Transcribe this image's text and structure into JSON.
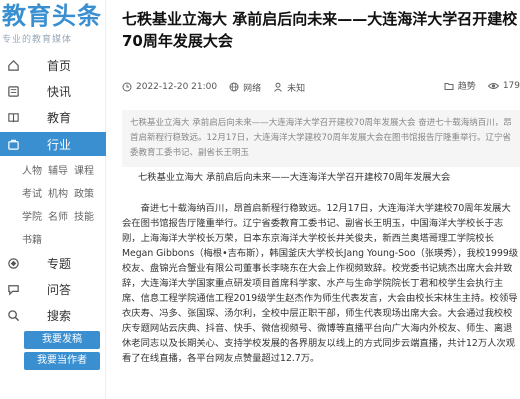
{
  "logo": {
    "main": "教育头条",
    "sub": "专业的教育媒体"
  },
  "nav": {
    "home": "首页",
    "news": "快讯",
    "education": "教育",
    "industry": "行业",
    "sub_items": [
      "人物",
      "辅导",
      "课程",
      "考试",
      "机构",
      "政策",
      "学院",
      "名师",
      "技能",
      "书籍"
    ],
    "topics": "专题",
    "community": "问答",
    "search": "搜索",
    "publish_btn": "我要发稿",
    "owner_btn": "我要当作者"
  },
  "article": {
    "title": "七秩基业立海大 承前启后向未来——大连海洋大学召开建校70周年发展大会",
    "date": "2022-12-20 21:00",
    "source": "网络",
    "author": "未知",
    "category": "趋势",
    "views": "179",
    "summary": "七秩基业立海大 承前启后向未来——大连海洋大学召开建校70周年发展大会 奋进七十载海纳百川，昂首启新程行稳致远。12月17日，大连海洋大学建校70周年发展大会在图书馆报告厅隆重举行。辽宁省委教育工委书记、副省长王明玉",
    "heading": "七秩基业立海大 承前启后向未来——大连海洋大学召开建校70周年发展大会",
    "body": "奋进七十载海纳百川，昂首启新程行稳致远。12月17日，大连海洋大学建校70周年发展大会在图书馆报告厅隆重举行。辽宁省委教育工委书记、副省长王明玉，中国海洋大学校长于志刚，上海海洋大学校长万荣，日本东京海洋大学校长井关俊夫，新西兰奥塔哥理工学院校长Megan Gibbons（梅根•吉布斯），韩国釜庆大学校长Jang Young-Soo（张瑛秀），我校1999级校友、盘锦光合蟹业有限公司董事长李晓东在大会上作视频致辞。校党委书记姚杰出席大会并致辞，大连海洋大学国家重点研发项目首席科学家、水产与生命学院院长丁君和校学生会执行主席、信息工程学院通信工程2019级学生赵杰作为师生代表发言，大会由校长宋林生主持。校领导衣庆寿、冯多、张国琛、汤尔利，全校中层正职干部，师生代表现场出席大会。大会通过我校校庆专题网站云庆典、抖音、快手、微信视频号、微博等直播平台向广大海内外校友、师生、离退休老同志以及长期关心、支持学校发展的各界朋友以线上的方式同步云端直播，共计12万人次观看了在线直播，各平台网友点赞量超过12.7万。"
  },
  "colors": {
    "accent": "#3a8fd0"
  }
}
